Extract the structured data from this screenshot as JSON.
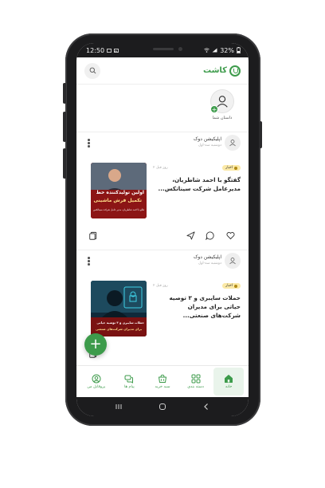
{
  "status_bar": {
    "time": "12:50",
    "battery": "32%"
  },
  "header": {
    "brand_name": "کاشت"
  },
  "stories": {
    "my_story_label": "داستان شما"
  },
  "posts": [
    {
      "author": "اپلیکیشن دوک",
      "author_time": "دوشنبه سه-اول",
      "tag": "اخبار",
      "date": "۲ روز قبل",
      "title": "گفتگو با احمد شاطریان، مدیرعامل شرکت سیناتکس...",
      "thumb_text_1": "اولین تولیدکننده خط",
      "thumb_text_2": "تکمیل فرش ماشینی",
      "thumb_caption": "گفتگو با احمد شاطریان، مدیر عامل شرکت سیناتکس"
    },
    {
      "author": "اپلیکیشن دوک",
      "author_time": "دوشنبه سه-اول",
      "tag": "اخبار",
      "date": "۲ روز قبل",
      "title": "حملات سایبری و ۳ توصیه حیاتی برای مدیران شرکت‌های صنعتی...",
      "thumb_text_1": "حملات سایبری و ۳ توصیه حیاتی",
      "thumb_text_2": "برای مدیران شرکت‌های صنعتی"
    }
  ],
  "bottom_nav": [
    {
      "label": "پروفایل من",
      "icon": "profile-icon"
    },
    {
      "label": "پیام ها",
      "icon": "chat-icon"
    },
    {
      "label": "سبد خرید",
      "icon": "cart-icon"
    },
    {
      "label": "دسته بندی",
      "icon": "grid-icon"
    },
    {
      "label": "خانه",
      "icon": "home-icon",
      "active": true
    }
  ],
  "colors": {
    "accent": "#3d9b4b",
    "tag_bg": "#fbe9a6",
    "frame": "#1c1c1e"
  }
}
